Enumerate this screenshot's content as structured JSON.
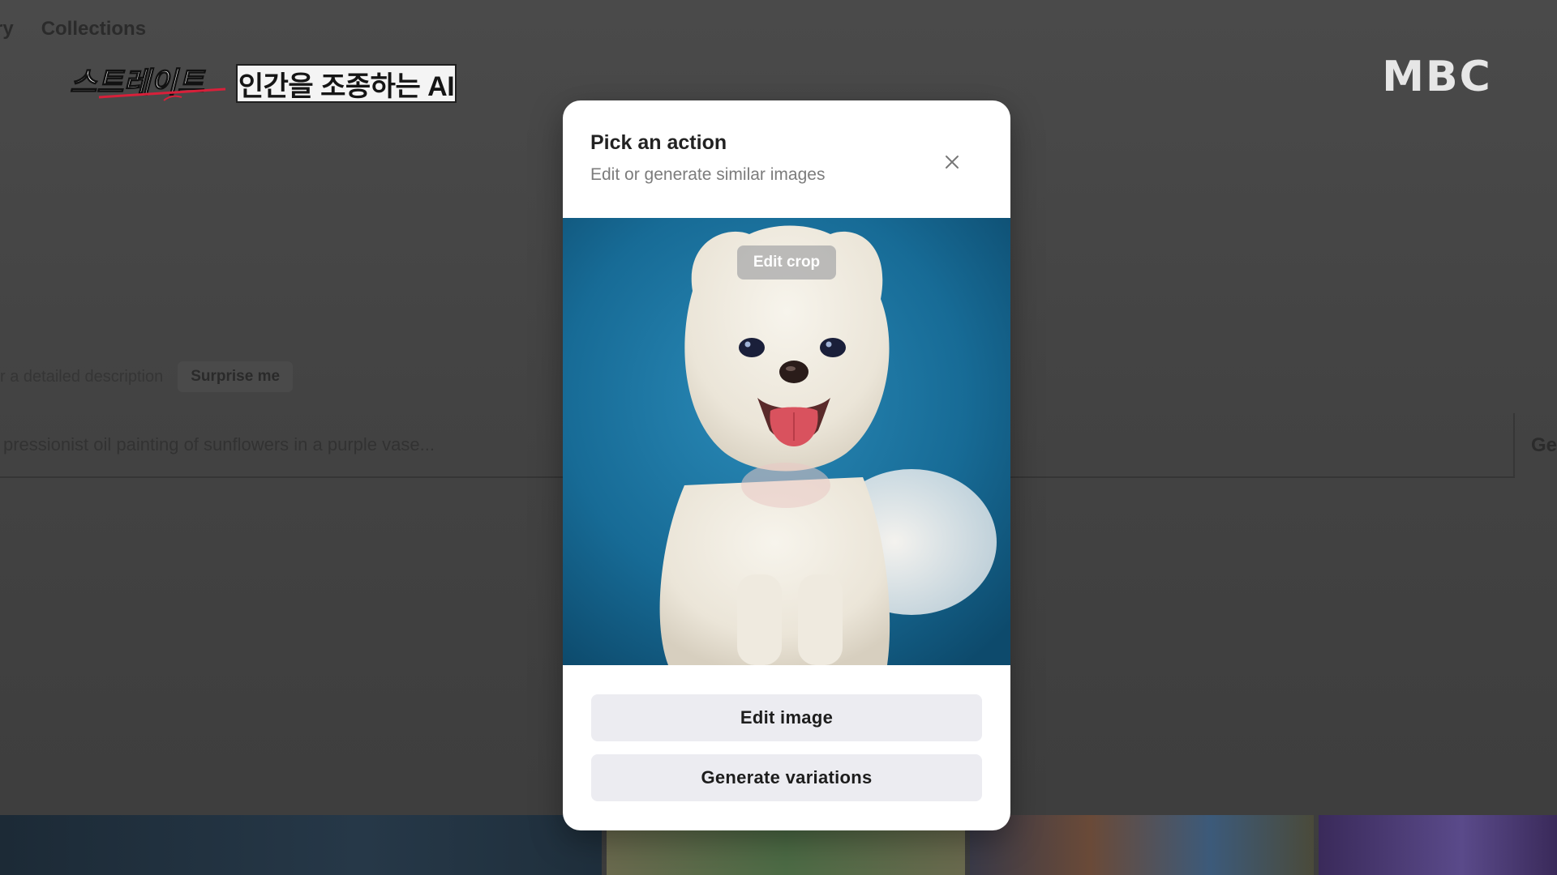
{
  "background_page": {
    "nav": {
      "partial_label": "ry",
      "collections_label": "Collections"
    },
    "prompt_hint": "r a detailed description",
    "surprise_button_label": "Surprise me",
    "prompt_placeholder": "pressionist oil painting of sunflowers in a purple vase...",
    "generate_button_label": "Ge"
  },
  "broadcast": {
    "show_logo_text": "스트레이트",
    "caption": "인간을 조종하는 AI",
    "network_logo_text": "MBC"
  },
  "modal": {
    "title": "Pick an action",
    "subtitle": "Edit or generate similar images",
    "close_icon": "close-icon",
    "edit_crop_label": "Edit crop",
    "edit_image_label": "Edit image",
    "generate_variations_label": "Generate variations"
  },
  "colors": {
    "overlay": "#454545",
    "modal_background": "#ffffff",
    "button_background": "#ececf1",
    "image_background": "#1b6e98"
  }
}
